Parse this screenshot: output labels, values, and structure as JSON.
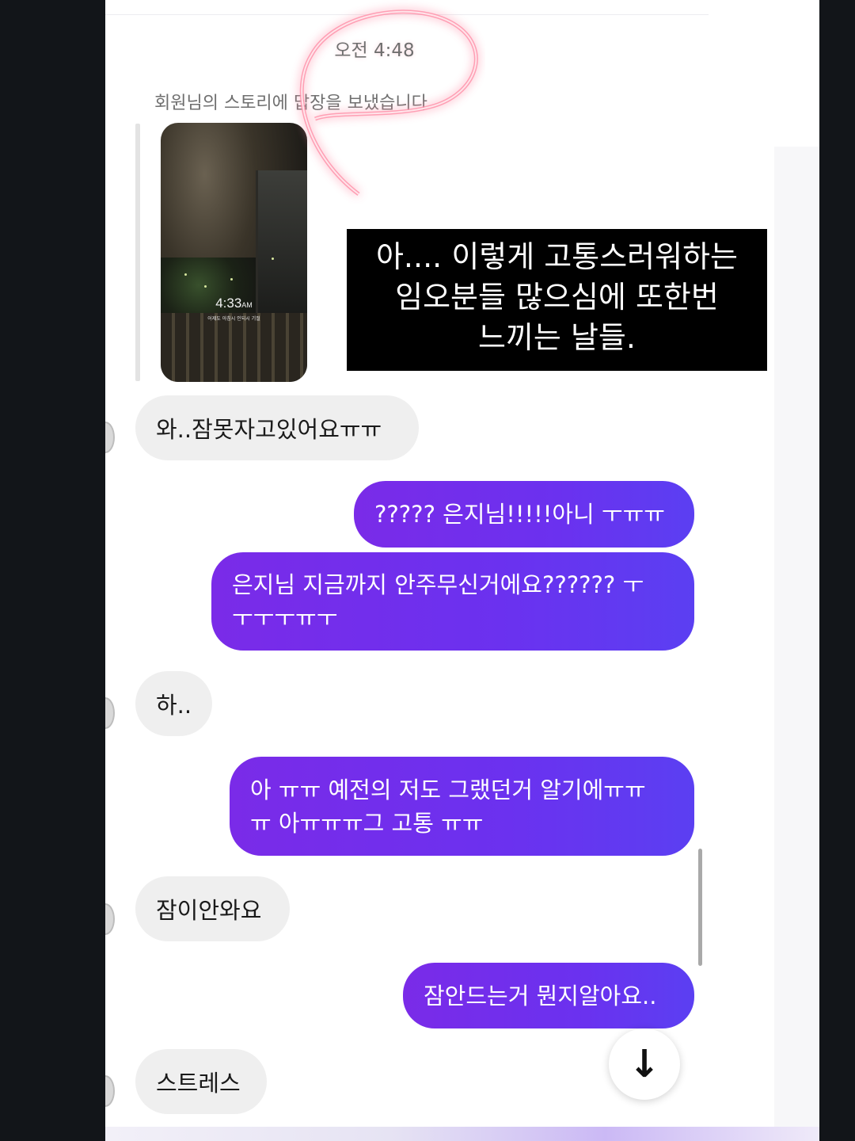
{
  "thread": {
    "timestamp": "오전 4:48",
    "story_reply_note": "회원님의 스토리에 답장을 보냈습니다"
  },
  "story": {
    "time": "4:33",
    "am": "AM",
    "caption": "어제도 아침시 인되시 기절"
  },
  "overlay_caption": {
    "line1": "아.... 이렇게 고통스러워하는",
    "line2": "임오분들 많으심에 또한번",
    "line3": "느끼는 날들."
  },
  "messages": [
    {
      "side": "in",
      "text": "와..잠못자고있어요ㅠㅠ"
    },
    {
      "side": "out",
      "text": "????? 은지님!!!!!아니 ㅜㅠㅠ"
    },
    {
      "side": "out",
      "line1": "은지님 지금까지 안주무신거에요?????? ㅜ",
      "line2": "ㅜㅜㅜㅠㅜ"
    },
    {
      "side": "in",
      "text": "하.."
    },
    {
      "side": "out",
      "line1": "아 ㅠㅠ 예전의 저도 그랬던거 알기에ㅠㅠ",
      "line2": "ㅠ 아ㅠㅠㅠ그 고통 ㅠㅠ"
    },
    {
      "side": "in",
      "text": "잠이안와요"
    },
    {
      "side": "out",
      "text": "잠안드는거 뭔지알아요.."
    },
    {
      "side": "in",
      "text": "스트레스"
    }
  ],
  "controls": {
    "scroll_down_icon": "arrow-down-icon",
    "scroll_down_glyph": "↓"
  },
  "colors": {
    "outgoing_bubble": "#6b31ef",
    "incoming_bubble": "#efefef",
    "neon_accent": "#ff8fa8"
  }
}
